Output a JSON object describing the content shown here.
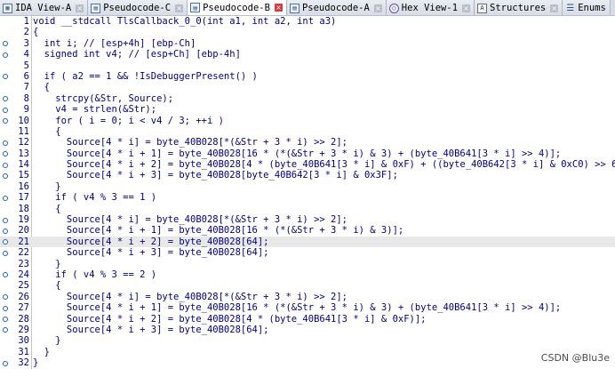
{
  "tabs": [
    {
      "label": "IDA View-A",
      "icon": "ida-view-icon",
      "active": false
    },
    {
      "label": "Pseudocode-C",
      "icon": "pseudocode-icon",
      "active": false
    },
    {
      "label": "Pseudocode-B",
      "icon": "pseudocode-icon",
      "active": true
    },
    {
      "label": "Pseudocode-A",
      "icon": "pseudocode-icon",
      "active": false
    },
    {
      "label": "Hex View-1",
      "icon": "hex-view-icon",
      "active": false
    },
    {
      "label": "Structures",
      "icon": "structures-icon",
      "active": false
    },
    {
      "label": "Enums",
      "icon": "enums-icon",
      "active": false
    }
  ],
  "close_glyph": "×",
  "highlighted_line": 21,
  "lines": [
    {
      "n": "1",
      "t": "void __stdcall TlsCallback_0_0(int a1, int a2, int a3)"
    },
    {
      "n": "2",
      "t": "{"
    },
    {
      "n": "3",
      "t": "  int i; // [esp+4h] [ebp-Ch]"
    },
    {
      "n": "4",
      "t": "  signed int v4; // [esp+Ch] [ebp-4h]"
    },
    {
      "n": "5",
      "t": ""
    },
    {
      "n": "6",
      "t": "  if ( a2 == 1 && !IsDebuggerPresent() )"
    },
    {
      "n": "7",
      "t": "  {"
    },
    {
      "n": "8",
      "t": "    strcpy(&Str, Source);"
    },
    {
      "n": "9",
      "t": "    v4 = strlen(&Str);"
    },
    {
      "n": "10",
      "t": "    for ( i = 0; i < v4 / 3; ++i )"
    },
    {
      "n": "11",
      "t": "    {"
    },
    {
      "n": "12",
      "t": "      Source[4 * i] = byte_40B028[*(&Str + 3 * i) >> 2];"
    },
    {
      "n": "13",
      "t": "      Source[4 * i + 1] = byte_40B028[16 * (*(&Str + 3 * i) & 3) + (byte_40B641[3 * i] >> 4)];"
    },
    {
      "n": "14",
      "t": "      Source[4 * i + 2] = byte_40B028[4 * (byte_40B641[3 * i] & 0xF) + ((byte_40B642[3 * i] & 0xC0) >> 6)];"
    },
    {
      "n": "15",
      "t": "      Source[4 * i + 3] = byte_40B028[byte_40B642[3 * i] & 0x3F];"
    },
    {
      "n": "16",
      "t": "    }"
    },
    {
      "n": "17",
      "t": "    if ( v4 % 3 == 1 )"
    },
    {
      "n": "18",
      "t": "    {"
    },
    {
      "n": "19",
      "t": "      Source[4 * i] = byte_40B028[*(&Str + 3 * i) >> 2];"
    },
    {
      "n": "20",
      "t": "      Source[4 * i + 1] = byte_40B028[16 * (*(&Str + 3 * i) & 3)];"
    },
    {
      "n": "21",
      "t": "      Source[4 * i + 2] = byte_40B028[64];"
    },
    {
      "n": "22",
      "t": "      Source[4 * i + 3] = byte_40B028[64];"
    },
    {
      "n": "23",
      "t": "    }"
    },
    {
      "n": "24",
      "t": "    if ( v4 % 3 == 2 )"
    },
    {
      "n": "25",
      "t": "    {"
    },
    {
      "n": "26",
      "t": "      Source[4 * i] = byte_40B028[*(&Str + 3 * i) >> 2];"
    },
    {
      "n": "27",
      "t": "      Source[4 * i + 1] = byte_40B028[16 * (*(&Str + 3 * i) & 3) + (byte_40B641[3 * i] >> 4)];"
    },
    {
      "n": "28",
      "t": "      Source[4 * i + 2] = byte_40B028[4 * (byte_40B641[3 * i] & 0xF)];"
    },
    {
      "n": "29",
      "t": "      Source[4 * i + 3] = byte_40B028[64];"
    },
    {
      "n": "30",
      "t": "    }"
    },
    {
      "n": "31",
      "t": "  }"
    },
    {
      "n": "32",
      "t": "}"
    }
  ],
  "breakpoint_lines": [
    "3",
    "4",
    "6",
    "8",
    "9",
    "10",
    "12",
    "13",
    "14",
    "15",
    "17",
    "19",
    "20",
    "21",
    "22",
    "24",
    "26",
    "27",
    "28",
    "29",
    "32"
  ],
  "watermark": "CSDN @Blu3e"
}
